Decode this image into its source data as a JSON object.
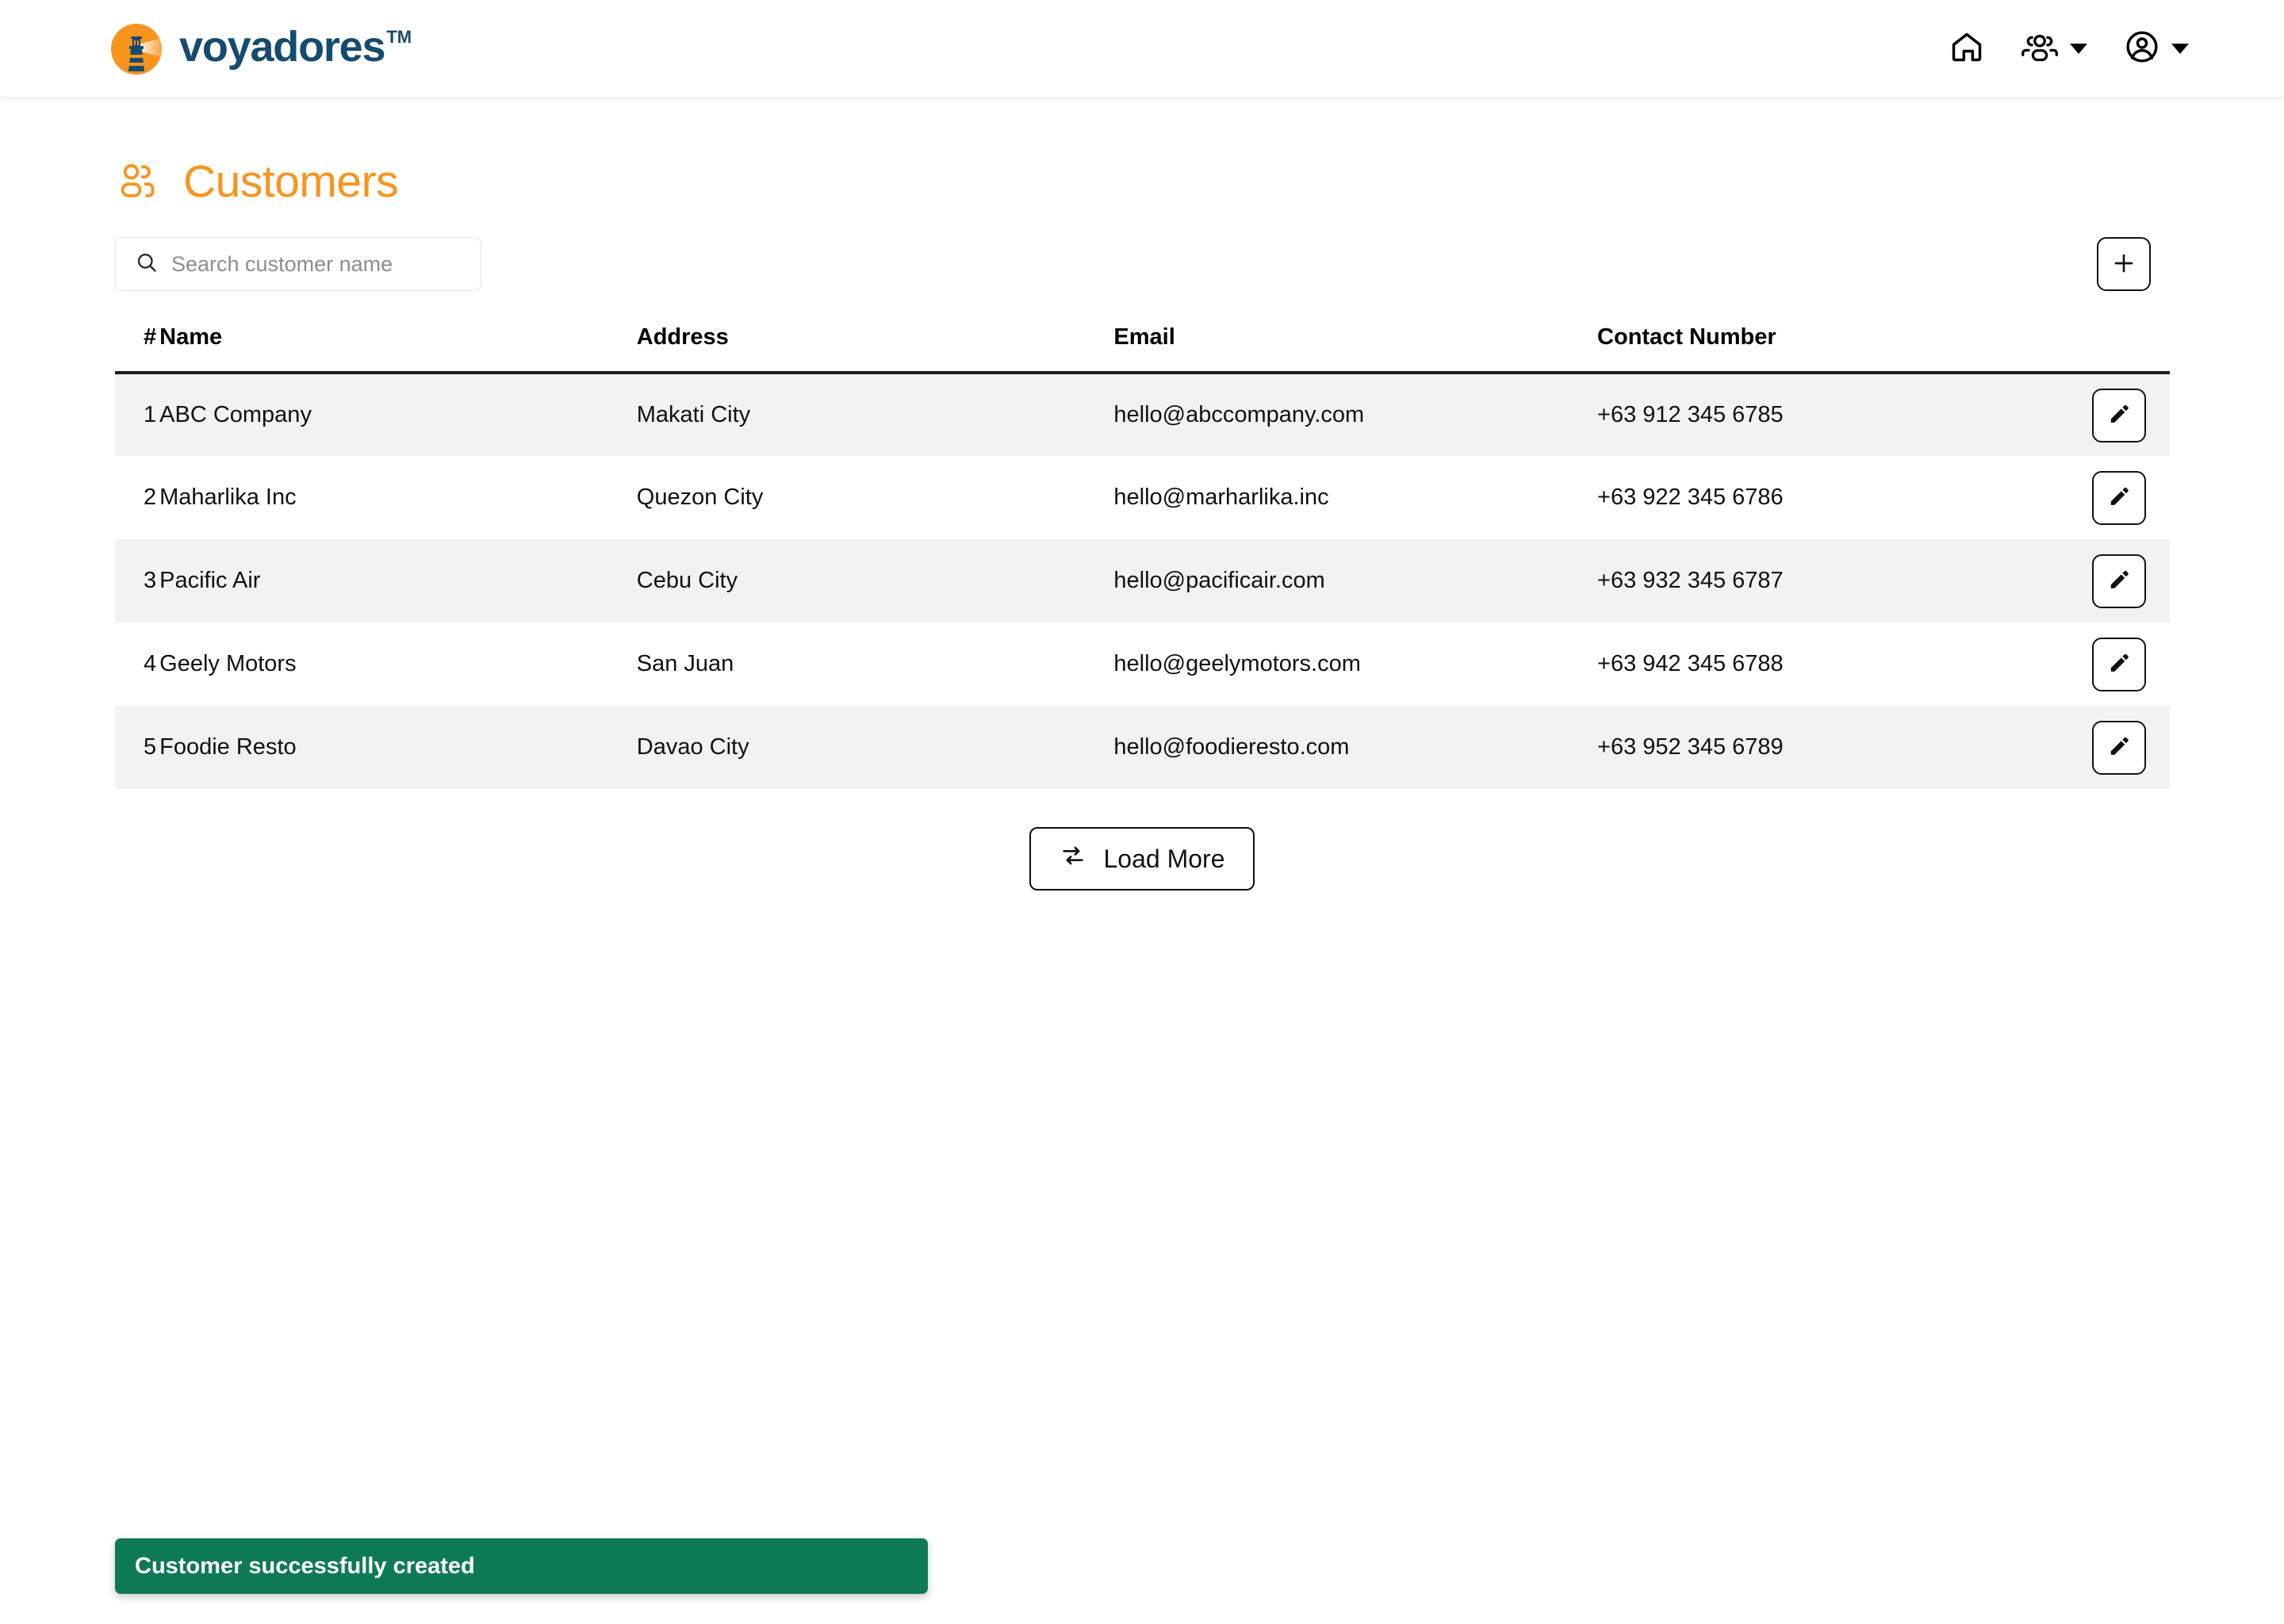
{
  "brand": {
    "name": "voyadores",
    "trademark": "TM",
    "logo_icon": "lighthouse-icon",
    "text_color": "#154b6e",
    "mark_color": "#f7941e"
  },
  "navbar": {
    "items": [
      {
        "icon": "home-icon",
        "label": "Home",
        "has_caret": false
      },
      {
        "icon": "users-group-icon",
        "label": "Customers",
        "has_caret": true
      },
      {
        "icon": "user-circle-icon",
        "label": "Account",
        "has_caret": true
      }
    ]
  },
  "page": {
    "title": "Customers",
    "title_icon": "users-group-icon",
    "title_color": "#f7941e"
  },
  "search": {
    "placeholder": "Search customer name",
    "value": "",
    "icon": "search-icon"
  },
  "add_button": {
    "icon": "plus-icon",
    "label": "+"
  },
  "table": {
    "columns": [
      "#",
      "Name",
      "Address",
      "Email",
      "Contact Number"
    ],
    "row_action_icon": "pencil-icon",
    "rows": [
      {
        "num": "1",
        "name": "ABC Company",
        "address": "Makati City",
        "email": "hello@abccompany.com",
        "contact": "+63 912 345 6785"
      },
      {
        "num": "2",
        "name": "Maharlika Inc",
        "address": "Quezon City",
        "email": "hello@marharlika.inc",
        "contact": "+63 922 345 6786"
      },
      {
        "num": "3",
        "name": "Pacific Air",
        "address": "Cebu City",
        "email": "hello@pacificair.com",
        "contact": "+63 932 345 6787"
      },
      {
        "num": "4",
        "name": "Geely Motors",
        "address": "San Juan",
        "email": "hello@geelymotors.com",
        "contact": "+63 942 345 6788"
      },
      {
        "num": "5",
        "name": "Foodie Resto",
        "address": "Davao City",
        "email": "hello@foodieresto.com",
        "contact": "+63 952 345 6789"
      }
    ]
  },
  "load_more": {
    "label": "Load More",
    "icon": "repeat-arrows-icon"
  },
  "toast": {
    "message": "Customer successfully created",
    "background": "#0d7a55",
    "text_color": "#ffffff"
  }
}
